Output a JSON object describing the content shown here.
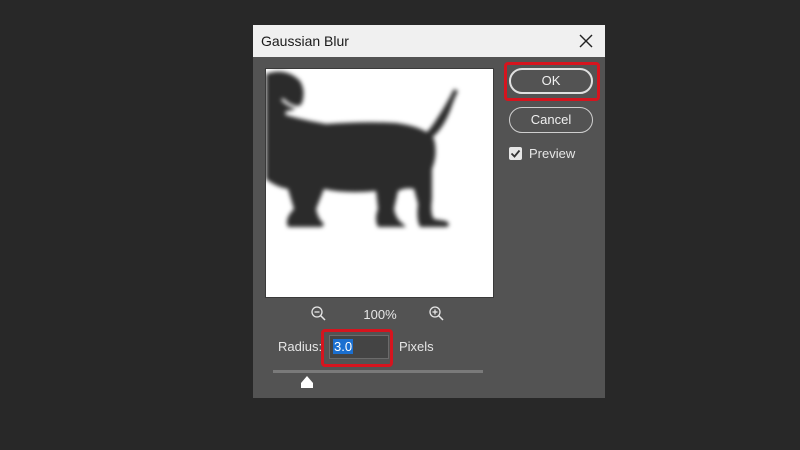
{
  "dialog": {
    "title": "Gaussian Blur",
    "close_icon": "close-icon"
  },
  "zoom": {
    "zoom_out_icon": "zoom-out-icon",
    "level": "100%",
    "zoom_in_icon": "zoom-in-icon"
  },
  "radius": {
    "label": "Radius:",
    "value": "3.0",
    "unit": "Pixels",
    "slider_fraction": 0.16
  },
  "buttons": {
    "ok_label": "OK",
    "cancel_label": "Cancel"
  },
  "preview": {
    "label": "Preview",
    "checked": true
  },
  "colors": {
    "highlight": "#d6141e",
    "dialog_bg": "#535353",
    "selection": "#1a6fd0"
  }
}
